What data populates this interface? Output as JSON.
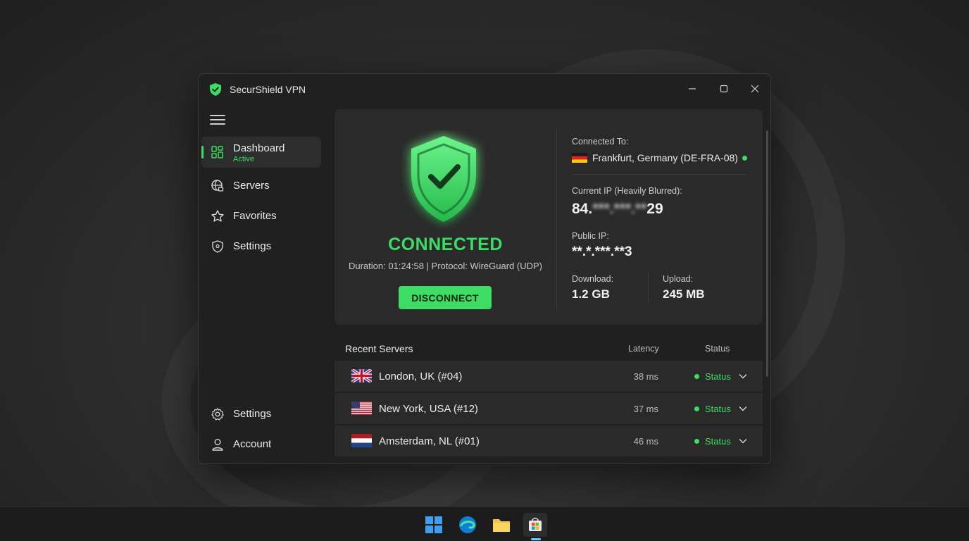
{
  "window": {
    "title": "SecurShield VPN"
  },
  "sidebar": {
    "items": [
      {
        "label": "Dashboard",
        "sublabel": "Active",
        "icon": "dashboard-icon"
      },
      {
        "label": "Servers",
        "icon": "globe-lock-icon"
      },
      {
        "label": "Favorites",
        "icon": "star-icon"
      },
      {
        "label": "Settings",
        "icon": "shield-icon"
      }
    ],
    "bottom_items": [
      {
        "label": "Settings",
        "icon": "gear-icon"
      },
      {
        "label": "Account",
        "icon": "user-icon"
      }
    ]
  },
  "connection": {
    "status": "CONNECTED",
    "meta": "Duration: 01:24:58 | Protocol: WireGuard (UDP)",
    "disconnect_label": "DISCONNECT",
    "connected_to_label": "Connected To:",
    "location": "Frankfurt, Germany (DE-FRA-08)",
    "current_ip_label": "Current IP (Heavily Blurred):",
    "current_ip_prefix": "84.",
    "current_ip_blur": "***.***.**",
    "current_ip_suffix": "29",
    "public_ip_label": "Public IP:",
    "public_ip": "**.*.***.**3",
    "download_label": "Download:",
    "download_value": "1.2 GB",
    "upload_label": "Upload:",
    "upload_value": "245 MB"
  },
  "recent": {
    "title": "Recent Servers",
    "col_latency": "Latency",
    "col_status": "Status",
    "rows": [
      {
        "name": "London, UK (#04)",
        "latency": "38 ms",
        "status": "Status",
        "flag": "uk-flag"
      },
      {
        "name": "New York, USA (#12)",
        "latency": "37 ms",
        "status": "Status",
        "flag": "us-flag"
      },
      {
        "name": "Amsterdam, NL (#01)",
        "latency": "46 ms",
        "status": "Status",
        "flag": "nl-flag"
      }
    ]
  },
  "colors": {
    "accent": "#3ddc62",
    "background": "#202020",
    "panel": "#2a2a2a"
  },
  "taskbar": {
    "icons": [
      "windows-start-icon",
      "edge-browser-icon",
      "file-explorer-icon",
      "store-icon"
    ]
  }
}
